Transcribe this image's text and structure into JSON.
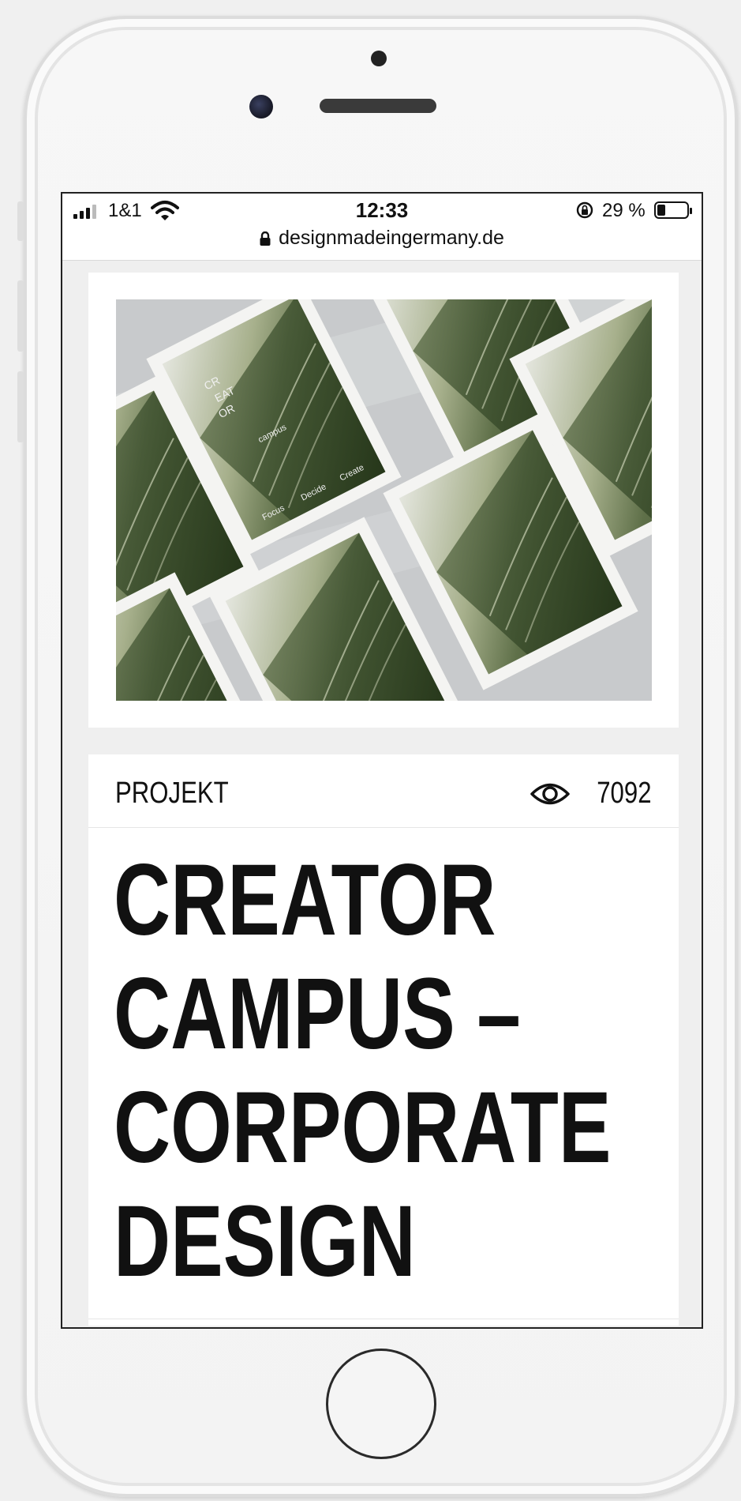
{
  "status_bar": {
    "carrier": "1&1",
    "time": "12:33",
    "battery_percent_text": "29 %",
    "battery_level": 0.29,
    "url": "designmadeingermany.de"
  },
  "project": {
    "category_label": "PROJEKT",
    "view_count": "7092",
    "title_lines": [
      "CREATOR",
      "CAMPUS –",
      "CORPORATE",
      "DESIGN"
    ]
  },
  "photo": {
    "poster_text": {
      "word_a": "CR",
      "word_b": "EAT",
      "word_c": "OR",
      "campus": "campus",
      "focus": "Focus",
      "decide": "Decide",
      "create": "Create"
    }
  }
}
